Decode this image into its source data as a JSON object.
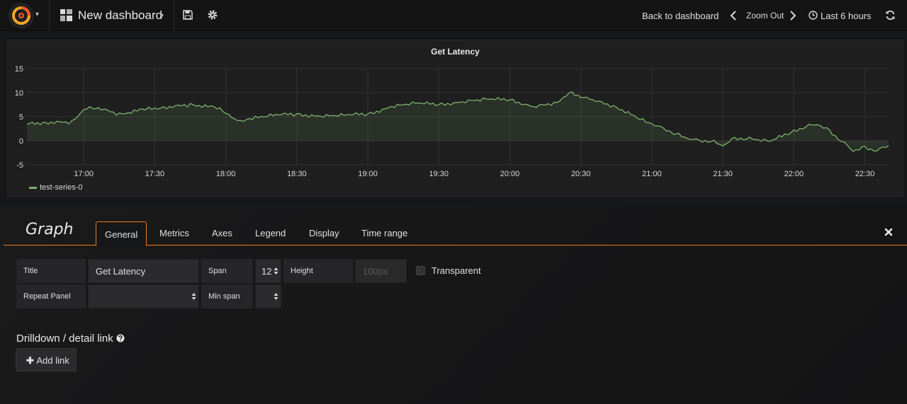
{
  "navbar": {
    "dashboard_title": "New dashboard",
    "back_label": "Back to dashboard",
    "zoom_label": "Zoom Out",
    "time_range_label": "Last 6 hours"
  },
  "panel": {
    "title": "Get Latency"
  },
  "chart_data": {
    "type": "area",
    "title": "Get Latency",
    "xlabel": "",
    "ylabel": "",
    "x_ticks": [
      "17:00",
      "17:30",
      "18:00",
      "18:30",
      "19:00",
      "19:30",
      "20:00",
      "20:30",
      "21:00",
      "21:30",
      "22:00",
      "22:30"
    ],
    "y_ticks": [
      15,
      10,
      5,
      0,
      -5
    ],
    "ylim": [
      -5,
      15
    ],
    "xlim": [
      "16:36",
      "22:40"
    ],
    "grid": true,
    "legend": "bottom-left",
    "series": [
      {
        "name": "test-series-0",
        "color": "#7eb26d",
        "x": [
          "16:36",
          "16:45",
          "16:55",
          "17:00",
          "17:05",
          "17:15",
          "17:25",
          "17:35",
          "17:45",
          "17:55",
          "18:00",
          "18:05",
          "18:10",
          "18:20",
          "18:30",
          "18:40",
          "18:50",
          "19:00",
          "19:10",
          "19:20",
          "19:30",
          "19:40",
          "19:50",
          "20:00",
          "20:10",
          "20:20",
          "20:25",
          "20:35",
          "20:45",
          "20:55",
          "21:00",
          "21:05",
          "21:10",
          "21:15",
          "21:20",
          "21:25",
          "21:30",
          "21:35",
          "21:40",
          "21:50",
          "22:00",
          "22:05",
          "22:10",
          "22:15",
          "22:20",
          "22:25",
          "22:30",
          "22:35",
          "22:40"
        ],
        "values": [
          3.5,
          3.8,
          3.9,
          6.5,
          7,
          5.5,
          6.5,
          7,
          7.5,
          7,
          6,
          4,
          4.5,
          5.5,
          5.5,
          5,
          5.5,
          5.5,
          7,
          8,
          7.5,
          8,
          8.8,
          8.5,
          7,
          8,
          10,
          8.5,
          7,
          4.5,
          3.5,
          2.5,
          1.5,
          0.5,
          0,
          0,
          -1,
          0.5,
          0.5,
          0,
          2,
          3,
          3.5,
          2,
          0,
          -2,
          -1.5,
          -2,
          -1
        ]
      }
    ]
  },
  "editor": {
    "heading": "Graph",
    "tabs": [
      "General",
      "Metrics",
      "Axes",
      "Legend",
      "Display",
      "Time range"
    ],
    "fields": {
      "title_label": "Title",
      "title_value": "Get Latency",
      "span_label": "Span",
      "span_value": "12",
      "height_label": "Height",
      "height_placeholder": "100px",
      "transparent_label": "Transparent",
      "repeat_label": "Repeat Panel",
      "minspan_label": "Min span"
    },
    "drilldown_title": "Drilldown / detail link",
    "add_link_label": "Add link"
  },
  "colors": {
    "accent": "#eb7b18",
    "series": "#7eb26d",
    "background": "#161719"
  }
}
